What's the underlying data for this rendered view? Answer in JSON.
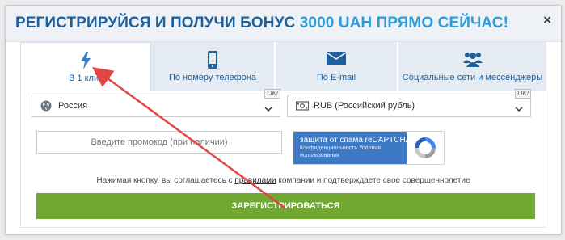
{
  "header": {
    "title_main": "РЕГИСТРИРУЙСЯ И ПОЛУЧИ БОНУС",
    "title_accent": "3000 UAH ПРЯМО СЕЙЧАС!",
    "close_glyph": "×"
  },
  "tabs": [
    {
      "label": "В 1 клик",
      "icon": "lightning-icon",
      "active": true
    },
    {
      "label": "По номеру телефона",
      "icon": "smartphone-icon",
      "active": false
    },
    {
      "label": "По E-mail",
      "icon": "envelope-icon",
      "active": false
    },
    {
      "label": "Социальные сети и мессенджеры",
      "icon": "users-icon",
      "active": false
    }
  ],
  "form": {
    "country": {
      "value": "Россия",
      "badge": "OK!",
      "icon": "globe-icon"
    },
    "currency": {
      "value": "RUB (Российский рубль)",
      "badge": "OK!",
      "icon": "banknote-icon"
    },
    "promo": {
      "placeholder": "Введите промокод (при наличии)"
    },
    "recaptcha": {
      "line1": "защита от спама reCAPTCHA",
      "line2": "Конфиденциальность   Условия",
      "line3": "использования"
    },
    "agreement": {
      "before": "Нажимая кнопку, вы соглашаетесь с ",
      "link": "правилами",
      "after": " компании и подтверждаете свое совершеннолетие"
    },
    "submit_label": "ЗАРЕГИСТРИРОВАТЬСЯ"
  },
  "colors": {
    "title": "#1e5f9d",
    "accent": "#2d9cdb",
    "tab_inactive": "#e4ebf3",
    "submit": "#71a832",
    "annotation_arrow": "#e0463f",
    "recaptcha_blue": "#3d79c4"
  }
}
